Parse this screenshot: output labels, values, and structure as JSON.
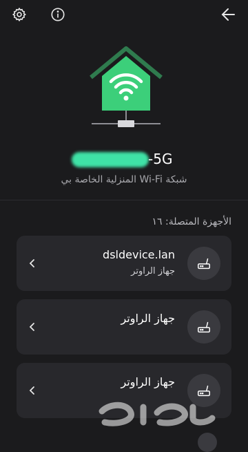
{
  "header": {
    "settings_icon": "gear-icon",
    "info_icon": "info-icon",
    "back_icon": "arrow-right-icon"
  },
  "network": {
    "ssid_suffix": "-5G",
    "ssid_color": "#3fe2a6",
    "subtitle": "شبكة Wi-Fi المنزلية الخاصة بي"
  },
  "devices": {
    "header": "الأجهزة المتصلة: ١٦",
    "items": [
      {
        "name": "dsldevice.lan",
        "type": "جهاز الراوتر",
        "icon": "router-icon"
      },
      {
        "name": "جهاز الراوتر",
        "type": "",
        "icon": "router-icon"
      },
      {
        "name": "جهاز الراوتر",
        "type": "",
        "icon": "router-icon"
      }
    ]
  },
  "colors": {
    "background": "#1b1b1d",
    "card": "#28282c",
    "accent": "#3fe2a6",
    "house_green": "#3ccf7a"
  },
  "watermark": "حراج"
}
